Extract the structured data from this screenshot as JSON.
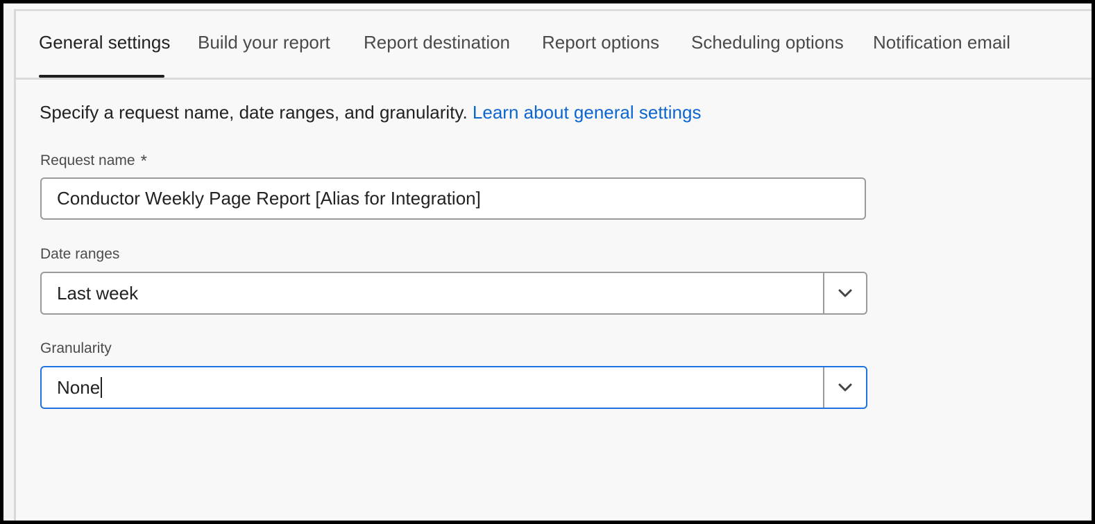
{
  "tabs": [
    {
      "label": "General settings",
      "selected": true
    },
    {
      "label": "Build your report",
      "selected": false
    },
    {
      "label": "Report destination",
      "selected": false
    },
    {
      "label": "Report options",
      "selected": false
    },
    {
      "label": "Scheduling options",
      "selected": false
    },
    {
      "label": "Notification email",
      "selected": false
    }
  ],
  "intro": {
    "text": "Specify a request name, date ranges, and granularity.",
    "link": "Learn about general settings"
  },
  "request_name": {
    "label": "Request name",
    "required_marker": "*",
    "value": "Conductor Weekly Page Report [Alias for Integration]"
  },
  "date_ranges": {
    "label": "Date ranges",
    "value": "Last week",
    "icon": "chevron-down-icon"
  },
  "granularity": {
    "label": "Granularity",
    "value": "None",
    "focused": true,
    "icon": "chevron-down-icon"
  },
  "colors": {
    "link": "#0d66d0",
    "focus_border": "#1f73e0",
    "tab_indicator": "#1e1e1e"
  }
}
